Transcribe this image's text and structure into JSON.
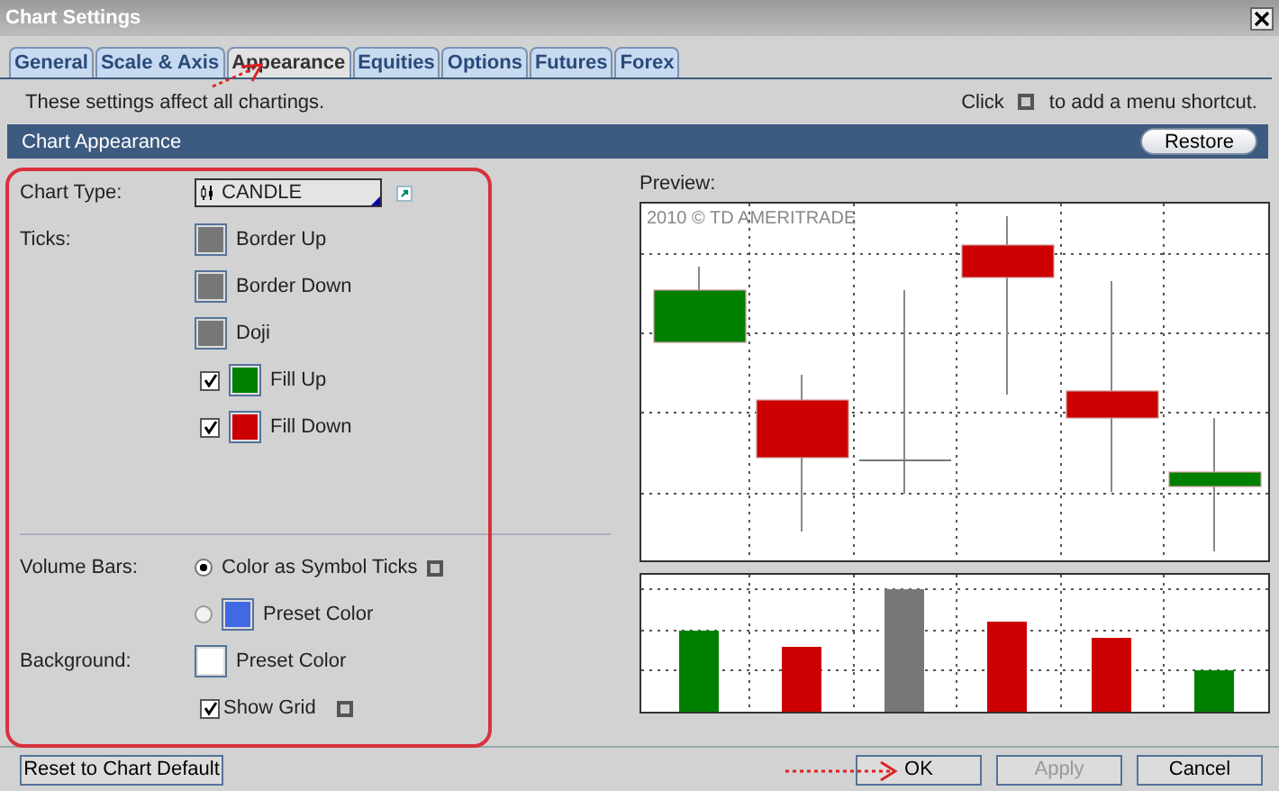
{
  "window": {
    "title": "Chart Settings"
  },
  "tabs": [
    {
      "label": "General",
      "selected": false
    },
    {
      "label": "Scale & Axis",
      "selected": false
    },
    {
      "label": "Appearance",
      "selected": true
    },
    {
      "label": "Equities",
      "selected": false
    },
    {
      "label": "Options",
      "selected": false
    },
    {
      "label": "Futures",
      "selected": false
    },
    {
      "label": "Forex",
      "selected": false
    }
  ],
  "info": "These settings affect all chartings.",
  "shortcut_hint": {
    "before": "Click",
    "after": "to add a menu shortcut."
  },
  "section": {
    "title": "Chart Appearance",
    "button": "Restore"
  },
  "chart_type": {
    "label": "Chart Type:",
    "value": "CANDLE"
  },
  "ticks": {
    "label": "Ticks:",
    "items": [
      {
        "kind": "swatch",
        "label": "Border Up",
        "color": "#777777"
      },
      {
        "kind": "swatch",
        "label": "Border Down",
        "color": "#777777"
      },
      {
        "kind": "swatch",
        "label": "Doji",
        "color": "#777777"
      },
      {
        "kind": "check_swatch",
        "label": "Fill Up",
        "color": "#008000",
        "checked": true
      },
      {
        "kind": "check_swatch",
        "label": "Fill Down",
        "color": "#cc0000",
        "checked": true
      }
    ]
  },
  "volume_bars": {
    "label": "Volume Bars:",
    "options": [
      {
        "kind": "plain",
        "label": "Color as Symbol Ticks",
        "selected": true
      },
      {
        "kind": "swatch",
        "label": "Preset Color",
        "color": "#4169e1",
        "selected": false
      }
    ]
  },
  "background": {
    "label": "Background:",
    "color": "#ffffff",
    "text": "Preset Color"
  },
  "show_grid": {
    "label": "Show Grid",
    "checked": true
  },
  "preview": {
    "label": "Preview:",
    "watermark": "2010 © TD AMERITRADE"
  },
  "buttons": [
    {
      "label": "Reset to Chart Default",
      "disabled": false
    },
    {
      "label": "OK",
      "disabled": false
    },
    {
      "label": "Apply",
      "disabled": true
    },
    {
      "label": "Cancel",
      "disabled": false
    }
  ]
}
